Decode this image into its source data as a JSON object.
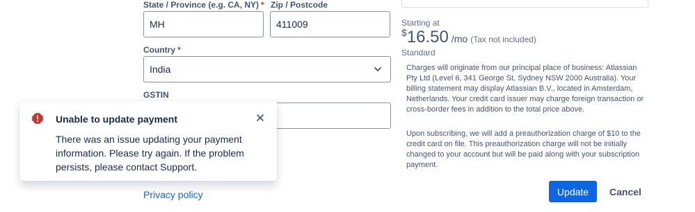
{
  "form": {
    "state": {
      "label": "State / Province (e.g. CA, NY)",
      "required_mark": "*",
      "value": "MH"
    },
    "zip": {
      "label": "Zip / Postcode",
      "value": "411009"
    },
    "country": {
      "label": "Country",
      "required_mark": "*",
      "value": "India"
    },
    "gstin": {
      "label": "GSTIN",
      "value": ""
    },
    "privacy_link": "Privacy policy"
  },
  "pricing": {
    "starting_label": "Starting at",
    "currency": "$",
    "amount": "16.50",
    "unit": "/mo",
    "tax_note": "(Tax not included)",
    "plan": "Standard"
  },
  "notes": {
    "charges": "Charges will originate from our principal place of business: Atlassian Pty Ltd (Level 6, 341 George St, Sydney NSW 2000 Australia). Your billing statement may display Atlassian B.V., located in Amsterdam, Netherlands. Your credit card issuer may charge foreign transaction or cross-border fees in addition to the total price above.",
    "preauth": "Upon subscribing, we will add a preauthorization charge of $10 to the credit card on file. This preauthorization charge will not be initially changed to your account but will be paid along with your subscription payment."
  },
  "actions": {
    "update_label": "Update",
    "cancel_label": "Cancel"
  },
  "flag": {
    "title": "Unable to update payment",
    "message": "There was an issue updating your payment information. Please try again. If the problem persists, please contact Support.",
    "icon": "error-icon"
  },
  "colors": {
    "primary": "#0c66e4",
    "danger": "#c9372c",
    "text": "#172b4d",
    "subtle": "#44546f"
  }
}
